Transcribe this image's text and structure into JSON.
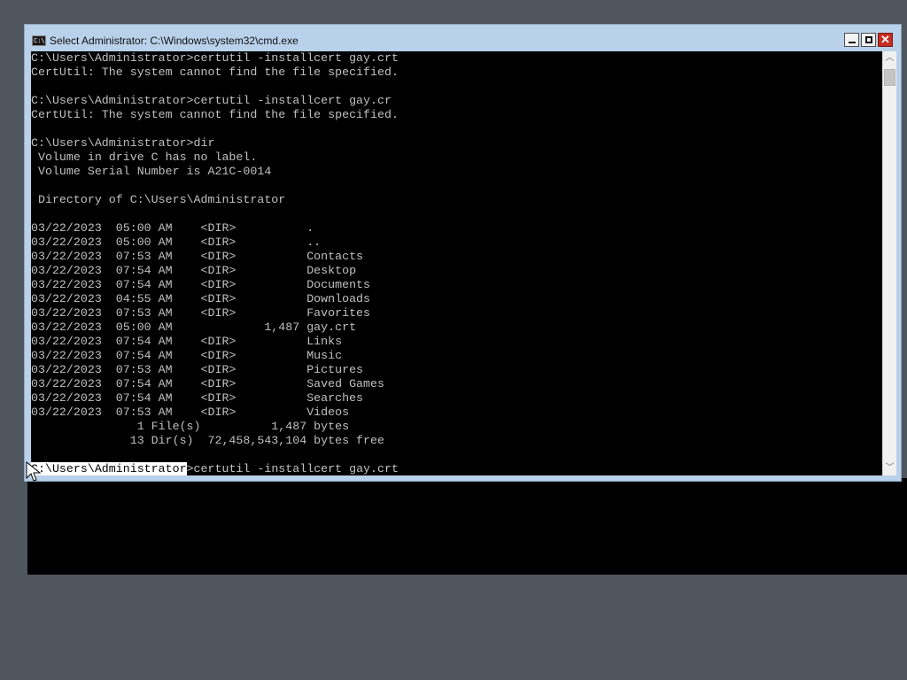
{
  "window": {
    "title": "Select Administrator: C:\\Windows\\system32\\cmd.exe",
    "icon": "cmd-icon"
  },
  "console": {
    "lines": [
      "C:\\Users\\Administrator>certutil -installcert gay.crt",
      "CertUtil: The system cannot find the file specified.",
      "",
      "C:\\Users\\Administrator>certutil -installcert gay.cr",
      "CertUtil: The system cannot find the file specified.",
      "",
      "C:\\Users\\Administrator>dir",
      " Volume in drive C has no label.",
      " Volume Serial Number is A21C-0014",
      "",
      " Directory of C:\\Users\\Administrator",
      "",
      "03/22/2023  05:00 AM    <DIR>          .",
      "03/22/2023  05:00 AM    <DIR>          ..",
      "03/22/2023  07:53 AM    <DIR>          Contacts",
      "03/22/2023  07:54 AM    <DIR>          Desktop",
      "03/22/2023  07:54 AM    <DIR>          Documents",
      "03/22/2023  04:55 AM    <DIR>          Downloads",
      "03/22/2023  07:53 AM    <DIR>          Favorites",
      "03/22/2023  05:00 AM             1,487 gay.crt",
      "03/22/2023  07:54 AM    <DIR>          Links",
      "03/22/2023  07:54 AM    <DIR>          Music",
      "03/22/2023  07:53 AM    <DIR>          Pictures",
      "03/22/2023  07:54 AM    <DIR>          Saved Games",
      "03/22/2023  07:54 AM    <DIR>          Searches",
      "03/22/2023  07:53 AM    <DIR>          Videos",
      "               1 File(s)          1,487 bytes",
      "              13 Dir(s)  72,458,543,104 bytes free",
      ""
    ],
    "current_prompt": {
      "selected": "C:\\Users\\Administrator",
      "rest": ">certutil -installcert gay.crt"
    }
  },
  "controls": {
    "minimize_icon": "minimize-icon",
    "maximize_icon": "maximize-icon",
    "close_icon": "close-icon",
    "close_glyph": "✕",
    "scroll_up_glyph": "︿",
    "scroll_down_glyph": "﹀"
  },
  "colors": {
    "desktop": "#4f565d",
    "window_frame": "#b9d1ea",
    "console_background": "#000000",
    "console_text": "#c0c0c0",
    "selection": "#ffffff",
    "close_button": "#c52d22"
  }
}
